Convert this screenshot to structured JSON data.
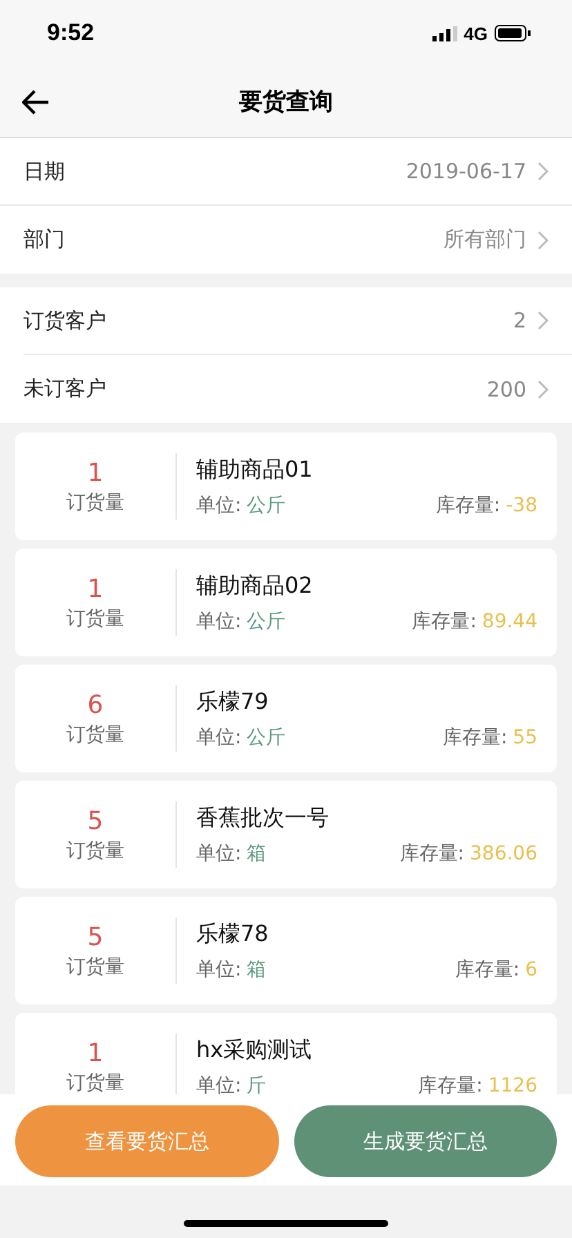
{
  "status_bar": {
    "time": "9:52",
    "network": "4G"
  },
  "nav": {
    "title": "要货查询"
  },
  "filters": [
    {
      "label": "日期",
      "value": "2019-06-17"
    },
    {
      "label": "部门",
      "value": "所有部门"
    }
  ],
  "customers": [
    {
      "label": "订货客户",
      "value": "2"
    },
    {
      "label": "未订客户",
      "value": "200"
    }
  ],
  "products": [
    {
      "qty": "1",
      "qty_label": "订货量",
      "name": "辅助商品01",
      "unit_label": "单位:",
      "unit": "公斤",
      "stock_label": "库存量:",
      "stock": "-38"
    },
    {
      "qty": "1",
      "qty_label": "订货量",
      "name": "辅助商品02",
      "unit_label": "单位:",
      "unit": "公斤",
      "stock_label": "库存量:",
      "stock": "89.44"
    },
    {
      "qty": "6",
      "qty_label": "订货量",
      "name": "乐檬79",
      "unit_label": "单位:",
      "unit": "公斤",
      "stock_label": "库存量:",
      "stock": "55"
    },
    {
      "qty": "5",
      "qty_label": "订货量",
      "name": "香蕉批次一号",
      "unit_label": "单位:",
      "unit": "箱",
      "stock_label": "库存量:",
      "stock": "386.06"
    },
    {
      "qty": "5",
      "qty_label": "订货量",
      "name": "乐檬78",
      "unit_label": "单位:",
      "unit": "箱",
      "stock_label": "库存量:",
      "stock": "6"
    },
    {
      "qty": "1",
      "qty_label": "订货量",
      "name": "hx采购测试",
      "unit_label": "单位:",
      "unit": "斤",
      "stock_label": "库存量:",
      "stock": "1126"
    }
  ],
  "buttons": [
    {
      "label": "查看要货汇总",
      "kind": "secondary"
    },
    {
      "label": "生成要货汇总",
      "kind": "primary"
    }
  ]
}
